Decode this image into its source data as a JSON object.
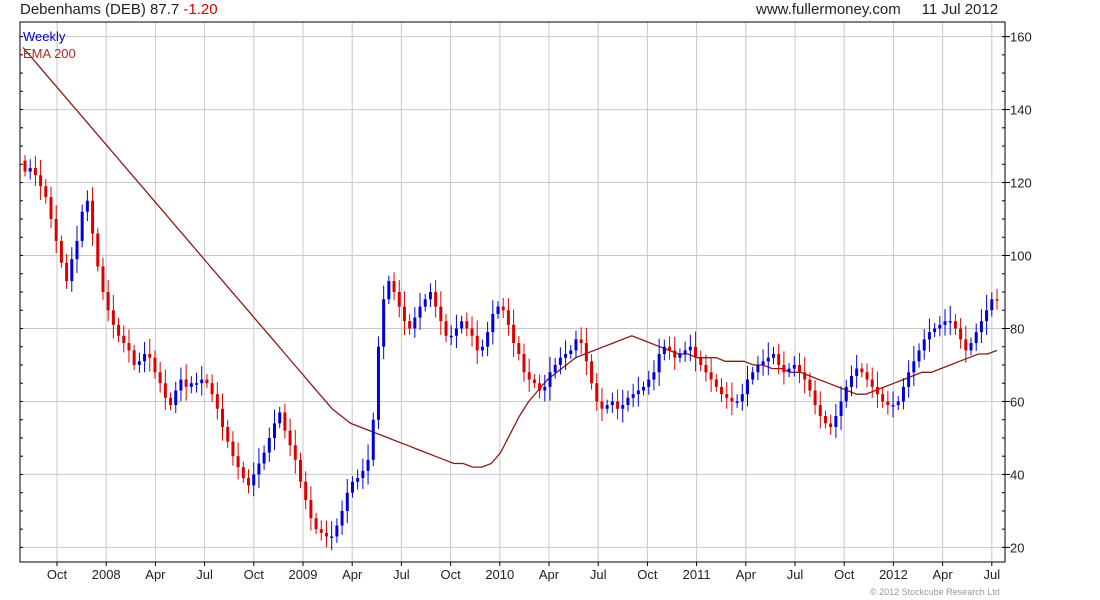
{
  "header": {
    "title": "Debenhams (DEB) 87.7",
    "change": "-1.20",
    "website": "www.fullermoney.com",
    "date": "11 Jul 2012"
  },
  "legend": {
    "series1": "Weekly",
    "series2": "EMA 200"
  },
  "copyright": "© 2012 Stockcube Research Ltd",
  "colors": {
    "up": "#0000dd",
    "down": "#dd0000",
    "ema": "#8b1a1a",
    "grid": "#c8c8c8",
    "text": "#222222"
  },
  "chart_data": {
    "type": "line",
    "subtype": "weekly candlestick with EMA 200 overlay",
    "x_ticks": [
      "Oct",
      "2008",
      "Apr",
      "Jul",
      "Oct",
      "2009",
      "Apr",
      "Jul",
      "Oct",
      "2010",
      "Apr",
      "Jul",
      "Oct",
      "2011",
      "Apr",
      "Jul",
      "Oct",
      "2012",
      "Apr",
      "Jul"
    ],
    "y_ticks": [
      20,
      40,
      60,
      80,
      100,
      120,
      140,
      160
    ],
    "ylim": [
      16,
      164
    ],
    "grid": true,
    "y_axis_side": "right",
    "series": [
      {
        "name": "Weekly",
        "values": [
          123,
          124,
          122,
          119,
          116,
          110,
          104,
          98,
          93,
          99,
          104,
          112,
          115,
          106,
          97,
          90,
          85,
          81,
          78,
          76,
          74,
          70,
          71,
          73,
          72,
          68,
          65,
          61,
          59,
          63,
          66,
          64,
          65,
          65,
          66,
          65,
          62,
          58,
          53,
          49,
          45,
          42,
          39,
          37,
          40,
          43,
          46,
          50,
          54,
          57,
          52,
          48,
          44,
          38,
          33,
          28,
          25,
          24,
          23,
          23,
          26,
          30,
          35,
          38,
          39,
          41,
          44,
          55,
          75,
          88,
          93,
          90,
          86,
          82,
          80,
          83,
          86,
          88,
          90,
          86,
          82,
          78,
          78,
          80,
          82,
          80,
          78,
          74,
          75,
          79,
          84,
          86,
          85,
          81,
          76,
          73,
          68,
          66,
          65,
          63,
          64,
          68,
          70,
          72,
          73,
          74,
          77,
          76,
          71,
          65,
          60,
          58,
          59,
          60,
          58,
          59,
          61,
          62,
          63,
          64,
          66,
          68,
          73,
          75,
          74,
          72,
          73,
          74,
          75,
          72,
          70,
          68,
          66,
          64,
          62,
          61,
          60,
          60,
          62,
          66,
          68,
          70,
          71,
          72,
          73,
          70,
          68,
          69,
          70,
          68,
          66,
          63,
          59,
          56,
          54,
          53,
          56,
          60,
          64,
          67,
          69,
          68,
          66,
          64,
          62,
          60,
          59,
          59,
          60,
          64,
          68,
          71,
          74,
          77,
          79,
          80,
          81,
          82,
          82,
          80,
          77,
          74,
          76,
          79,
          82,
          85,
          88,
          87.7
        ]
      },
      {
        "name": "EMA 200",
        "values": [
          157,
          154,
          151,
          148,
          145,
          142,
          139,
          136,
          133,
          130,
          127,
          124,
          121,
          118,
          115,
          112,
          109,
          106,
          103,
          100,
          97,
          94,
          91,
          88,
          85,
          82,
          79,
          76,
          73,
          70,
          67,
          64,
          61,
          58,
          56,
          54,
          53,
          52,
          51,
          50,
          49,
          48,
          47,
          46,
          45,
          44,
          43,
          43,
          42,
          42,
          43,
          46,
          51,
          56,
          60,
          63,
          66,
          68,
          70,
          72,
          73,
          74,
          75,
          76,
          77,
          78,
          77,
          76,
          75,
          74,
          73,
          73,
          72,
          72,
          72,
          71,
          71,
          71,
          70,
          70,
          69,
          69,
          68,
          68,
          67,
          66,
          65,
          64,
          63,
          62,
          62,
          63,
          64,
          65,
          66,
          67,
          68,
          68,
          69,
          70,
          71,
          72,
          73,
          73,
          74
        ]
      }
    ]
  }
}
